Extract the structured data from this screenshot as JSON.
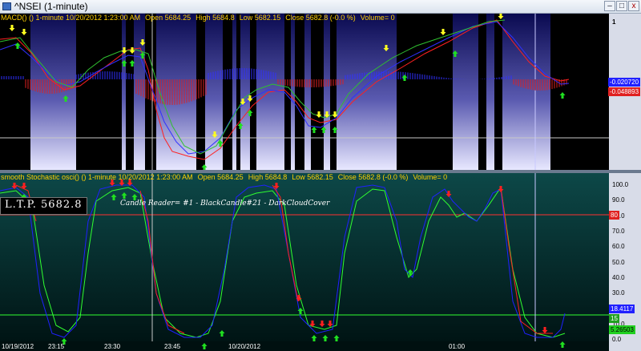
{
  "window": {
    "title": "^NSEI (1-minute)",
    "min": "–",
    "max": "□",
    "close": "x"
  },
  "macd_pane": {
    "header": {
      "name": "MACD() () 1-minute  10/20/2012 1:23:00 AM",
      "open": "Open 5684.25",
      "high": "High 5684.8",
      "low": "Low 5682.15",
      "close": "Close 5682.8 (-0.0 %)",
      "volume": "Volume= 0"
    },
    "axis_top": "1",
    "badge_macd": "-0.020720",
    "badge_signal": "-0.048893",
    "colors": {
      "bg_top": "#0a0a4a",
      "macd": "#2020ff",
      "signal": "#ff2020",
      "hist_pos": "#3030ff",
      "hist_neg": "#e02020"
    }
  },
  "stoch_pane": {
    "header": {
      "name": "smooth Stochastic osci() () 1-minute  10/20/2012 1:23:00 AM",
      "open": "Open 5684.25",
      "high": "High 5684.8",
      "low": "Low 5682.15",
      "close": "Close 5682.8 (-0.0 %)",
      "volume": "Volume= 0"
    },
    "ltp": "L.T.P.  5682.8",
    "pattern": "Candle Reader= #1 - BlackCandle#21 - DarkCloudCover",
    "y_axis": [
      "100.0",
      "90.0",
      "80.0",
      "70.0",
      "60.0",
      "50.0",
      "40.0",
      "30.0",
      "20.0",
      "10.0",
      "0.0"
    ],
    "badge_80": "80",
    "badge_k": "18.4117",
    "badge_15": "15",
    "badge_d": "5.26503",
    "colors": {
      "bg_top": "#0b3a3a",
      "bg_bottom": "#001010",
      "k": "#2020ff",
      "d": "#30ff30",
      "red": "#ff2020"
    }
  },
  "x_axis": [
    "10/19/2012",
    "23:15",
    "23:30",
    "23:45",
    "10/20/2012",
    "01:00"
  ]
}
